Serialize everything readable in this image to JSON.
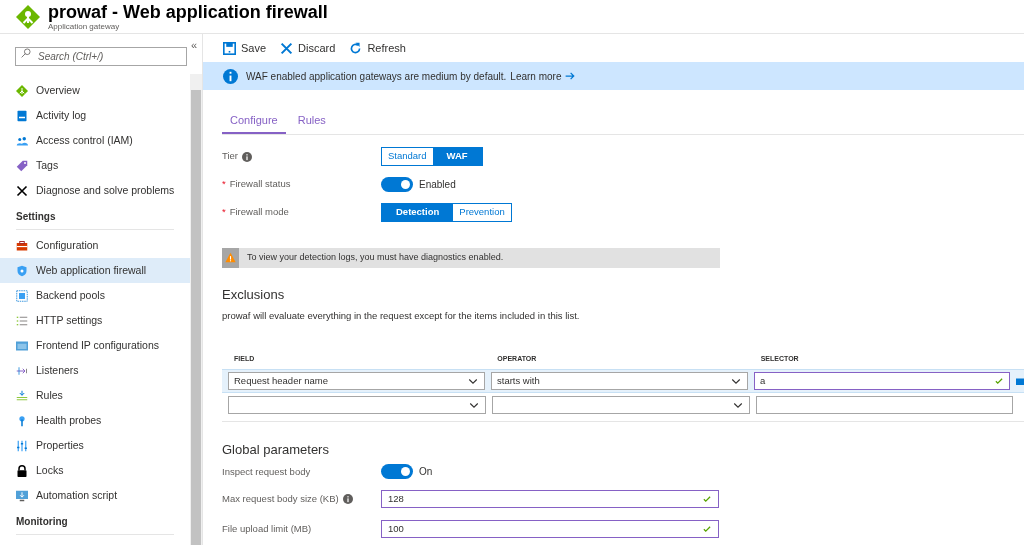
{
  "header": {
    "title": "prowaf - Web application firewall",
    "subtitle": "Application gateway"
  },
  "sidebar": {
    "search_placeholder": "Search (Ctrl+/)",
    "collapse": "«",
    "groups": [
      {
        "items": [
          {
            "label": "Overview",
            "selected": false
          },
          {
            "label": "Activity log",
            "selected": false
          },
          {
            "label": "Access control (IAM)",
            "selected": false
          },
          {
            "label": "Tags",
            "selected": false
          },
          {
            "label": "Diagnose and solve problems",
            "selected": false
          }
        ]
      },
      {
        "heading": "Settings",
        "items": [
          {
            "label": "Configuration",
            "selected": false
          },
          {
            "label": "Web application firewall",
            "selected": true
          },
          {
            "label": "Backend pools",
            "selected": false
          },
          {
            "label": "HTTP settings",
            "selected": false
          },
          {
            "label": "Frontend IP configurations",
            "selected": false
          },
          {
            "label": "Listeners",
            "selected": false
          },
          {
            "label": "Rules",
            "selected": false
          },
          {
            "label": "Health probes",
            "selected": false
          },
          {
            "label": "Properties",
            "selected": false
          },
          {
            "label": "Locks",
            "selected": false
          },
          {
            "label": "Automation script",
            "selected": false
          }
        ]
      },
      {
        "heading": "Monitoring"
      }
    ]
  },
  "toolbar": [
    {
      "kind": "save",
      "label": "Save"
    },
    {
      "kind": "discard",
      "label": "Discard"
    },
    {
      "kind": "refresh",
      "label": "Refresh"
    }
  ],
  "banner": {
    "text": "WAF enabled application gateways are medium by default.",
    "link": "Learn more"
  },
  "tabs": [
    {
      "label": "Configure",
      "selected": true
    },
    {
      "label": "Rules",
      "selected": false
    }
  ],
  "form": [
    {
      "kind": "segmented",
      "label": "Tier",
      "info": true,
      "options": [
        {
          "label": "Standard",
          "selected": false
        },
        {
          "label": "WAF",
          "selected": true
        }
      ]
    },
    {
      "kind": "toggle",
      "label": "Firewall status",
      "info": false,
      "required_mark": "*",
      "on": true,
      "value": "Enabled"
    },
    {
      "kind": "segmented",
      "label": "Firewall mode",
      "info": false,
      "required_mark": "*",
      "options": [
        {
          "label": "Detection",
          "selected": true
        },
        {
          "label": "Prevention",
          "selected": false
        }
      ]
    }
  ],
  "warning": "To view your detection logs, you must have diagnostics enabled.",
  "exclusions": {
    "heading": "Exclusions",
    "description": "prowaf will evaluate everything in the request except for the items included in this list.",
    "columns": [
      "FIELD",
      "OPERATOR",
      "SELECTOR"
    ],
    "rows": [
      {
        "field": "Request header name",
        "operator": "starts with",
        "selector": "a",
        "selected": true,
        "valid": true
      },
      {
        "selected": false,
        "valid": false
      }
    ]
  },
  "global": {
    "heading": "Global parameters",
    "params": [
      {
        "kind": "toggle",
        "label": "Inspect request body",
        "info": false,
        "on": true,
        "value": "On"
      },
      {
        "kind": "input",
        "label": "Max request body size (KB)",
        "info": true,
        "value": "128",
        "valid": true
      },
      {
        "kind": "input",
        "label": "File upload limit (MB)",
        "info": false,
        "value": "100",
        "valid": true
      }
    ]
  }
}
